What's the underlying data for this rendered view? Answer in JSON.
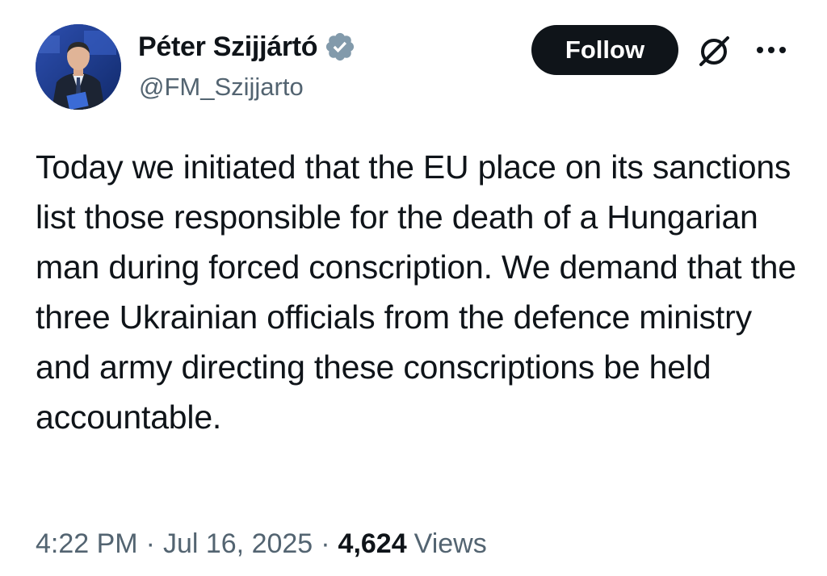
{
  "author": {
    "display_name": "Péter Szijjártó",
    "handle": "@FM_Szijjarto",
    "verified": true,
    "verified_color": "#829aab"
  },
  "actions": {
    "follow_label": "Follow",
    "grok_icon": "grok-slash-circle-icon",
    "more_icon": "more-dots-icon"
  },
  "tweet": {
    "text": "Today we initiated that the EU place on its sanctions list those responsible for the death of a Hungarian man during forced conscription. We demand that the three Ukrainian officials from the defence ministry and army directing these conscriptions be held accountable."
  },
  "meta": {
    "time": "4:22 PM",
    "separator": "·",
    "date": "Jul 16, 2025",
    "views_count": "4,624",
    "views_label": "Views"
  },
  "colors": {
    "text": "#0f1419",
    "secondary": "#536471",
    "button_bg": "#0f1419",
    "button_text": "#ffffff"
  }
}
